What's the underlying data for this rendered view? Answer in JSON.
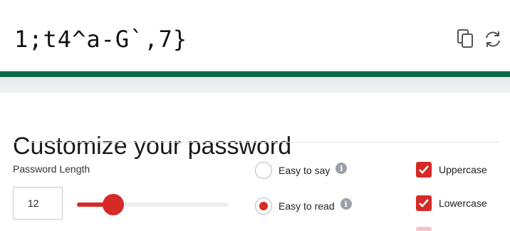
{
  "password": {
    "value": "1;t4^a-G`,7}"
  },
  "actions": {
    "copy_icon": "copy-icon",
    "refresh_icon": "refresh-icon"
  },
  "customize": {
    "title": "Customize your password",
    "length": {
      "label": "Password Length",
      "value": "12",
      "slider_fraction": 0.24
    },
    "modes": [
      {
        "label": "Easy to say",
        "selected": false
      },
      {
        "label": "Easy to read",
        "selected": true
      }
    ],
    "charsets": [
      {
        "label": "Uppercase",
        "checked": true
      },
      {
        "label": "Lowercase",
        "checked": true
      }
    ]
  },
  "colors": {
    "accent": "#d62a26",
    "brand_green": "#0a6b4b"
  }
}
